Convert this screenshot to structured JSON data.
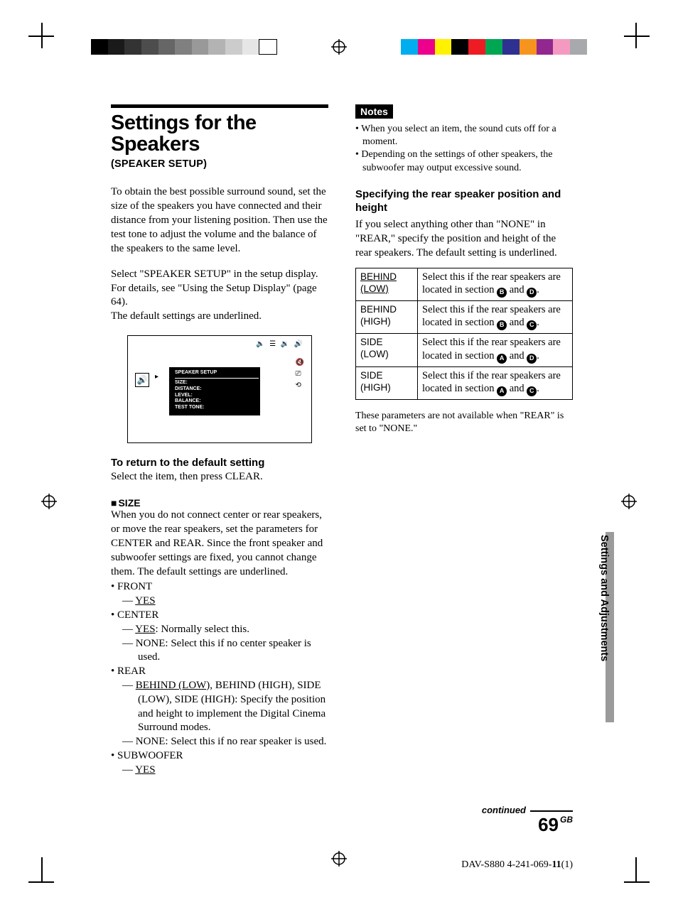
{
  "left": {
    "title": "Settings for the Speakers",
    "subtitle": "(SPEAKER SETUP)",
    "intro1": "To obtain the best possible surround sound, set the size of the speakers you have connected and their distance from your listening position. Then use the test tone to adjust the volume and the balance of the speakers to the same level.",
    "intro2a": "Select \"SPEAKER SETUP\" in the setup display. For details, see \"Using the Setup Display\" (page 64).",
    "intro2b": "The default settings are underlined.",
    "osd": {
      "heading": "SPEAKER SETUP",
      "items": [
        "SIZE:",
        "DISTANCE:",
        "LEVEL:",
        "BALANCE:",
        "TEST TONE:"
      ]
    },
    "h_return": "To return to the default setting",
    "p_return": "Select the item, then press CLEAR.",
    "h_size": "SIZE",
    "p_size": "When you do not connect center or rear speakers, or move the rear speakers, set the parameters for CENTER and REAR. Since the front speaker and subwoofer settings are fixed, you cannot change them. The default settings are underlined.",
    "list": {
      "front": "FRONT",
      "front_yes": "YES",
      "center": "CENTER",
      "center_yes_pre": "YES",
      "center_yes_post": ": Normally select this.",
      "center_none": "NONE: Select this if no center speaker is used.",
      "rear": "REAR",
      "rear_opt_pre": "BEHIND (LOW),",
      "rear_opt_post": " BEHIND (HIGH), SIDE (LOW), SIDE (HIGH): Specify the position and height to implement the Digital Cinema Surround modes.",
      "rear_none": "NONE: Select this if no rear speaker is used.",
      "sub": "SUBWOOFER",
      "sub_yes": "YES"
    }
  },
  "right": {
    "notes_label": "Notes",
    "notes": [
      "When you select an item, the sound cuts off for a moment.",
      "Depending on the settings of other speakers, the subwoofer may output excessive sound."
    ],
    "h_spec": "Specifying the rear speaker position and height",
    "p_spec": "If you select anything other than \"NONE\" in \"REAR,\" specify the position and height of the rear speakers. The default setting is underlined.",
    "table": [
      {
        "opt": "BEHIND (LOW)",
        "u": true,
        "desc_pre": "Select this if the rear speakers are located in section ",
        "a": "B",
        "mid": " and ",
        "b": "D",
        "desc_post": "."
      },
      {
        "opt": "BEHIND (HIGH)",
        "u": false,
        "desc_pre": "Select this if the rear speakers are located in section ",
        "a": "B",
        "mid": " and ",
        "b": "C",
        "desc_post": "."
      },
      {
        "opt": "SIDE (LOW)",
        "u": false,
        "desc_pre": "Select this if the rear speakers are located in section ",
        "a": "A",
        "mid": " and ",
        "b": "D",
        "desc_post": "."
      },
      {
        "opt": "SIDE (HIGH)",
        "u": false,
        "desc_pre": "Select this if the rear speakers are located in section ",
        "a": "A",
        "mid": " and ",
        "b": "C",
        "desc_post": "."
      }
    ],
    "tnote": "These parameters are not available when \"REAR\" is set to \"NONE.\""
  },
  "side_tab": "Settings and Adjustments",
  "footer": {
    "continued": "continued",
    "page_num": "69",
    "page_region": "GB",
    "doc_id_pre": "DAV-S880 4-241-069-",
    "doc_id_bold": "11",
    "doc_id_post": "(1)"
  }
}
